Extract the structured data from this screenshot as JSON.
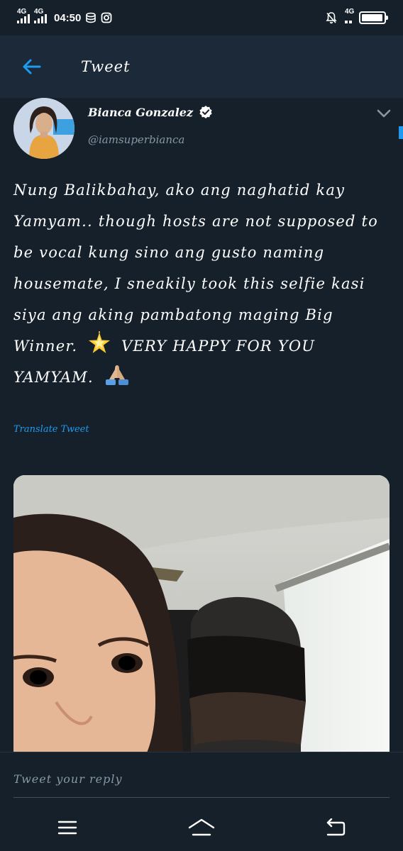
{
  "status_bar": {
    "network1": "4G",
    "network2": "4G",
    "time": "04:50",
    "network3": "4G",
    "battery_level": 0.95
  },
  "app_bar": {
    "title": "Tweet"
  },
  "tweet": {
    "author_name": "Bianca Gonzalez",
    "handle": "@iamsuperbianca",
    "text_part1": "Nung Balikbahay, ako ang naghatid kay Yamyam.. though hosts are not supposed to be vocal kung sino ang gusto naming housemate, I sneakily took this selfie kasi siya ang aking pambatong maging Big Winner.",
    "text_part2": "VERY HAPPY FOR YOU YAMYAM.",
    "translate_label": "Translate Tweet"
  },
  "reply": {
    "placeholder": "Tweet your reply"
  },
  "colors": {
    "background": "#15202b",
    "app_bar": "#1c2938",
    "accent": "#1d9bf0",
    "secondary_text": "#8899a6"
  },
  "icons": {
    "back": "arrow-left-icon",
    "verified": "verified-badge-icon",
    "more": "chevron-down-icon",
    "emoji1": "glowing-star-icon",
    "emoji2": "folded-hands-icon",
    "nav_menu": "menu-icon",
    "nav_home": "home-icon",
    "nav_back": "return-icon"
  }
}
